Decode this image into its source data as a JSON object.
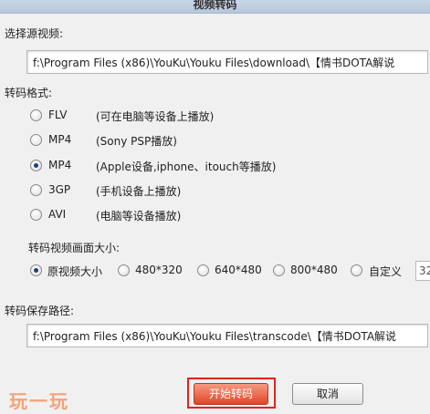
{
  "window": {
    "title": "视频转码"
  },
  "source": {
    "label": "选择源视频:",
    "path": "f:\\Program Files (x86)\\YouKu\\Youku Files\\download\\【情书DOTA解说"
  },
  "format": {
    "label": "转码格式:",
    "options": [
      {
        "name": "FLV",
        "desc": "(可在电脑等设备上播放)",
        "checked": false
      },
      {
        "name": "MP4",
        "desc": "(Sony PSP播放)",
        "checked": false
      },
      {
        "name": "MP4",
        "desc": "(Apple设备,iphone、itouch等播放)",
        "checked": true
      },
      {
        "name": "3GP",
        "desc": "(手机设备上播放)",
        "checked": false
      },
      {
        "name": "AVI",
        "desc": "(电脑等设备播放)",
        "checked": false
      }
    ]
  },
  "size": {
    "label": "转码视频画面大小:",
    "options": [
      {
        "name": "原视频大小",
        "checked": true
      },
      {
        "name": "480*320",
        "checked": false
      },
      {
        "name": "640*480",
        "checked": false
      },
      {
        "name": "800*480",
        "checked": false
      },
      {
        "name": "自定义",
        "checked": false
      }
    ],
    "custom_value": "32"
  },
  "output": {
    "label": "转码保存路径:",
    "path": "f:\\Program Files (x86)\\YouKu\\Youku Files\\transcode\\【情书DOTA解说"
  },
  "buttons": {
    "start": "开始转码",
    "cancel": "取消"
  },
  "watermark": "玩一玩",
  "colors": {
    "start_button": "#e2452a",
    "highlight": "#e0241b",
    "watermark": "#f3a37a"
  }
}
